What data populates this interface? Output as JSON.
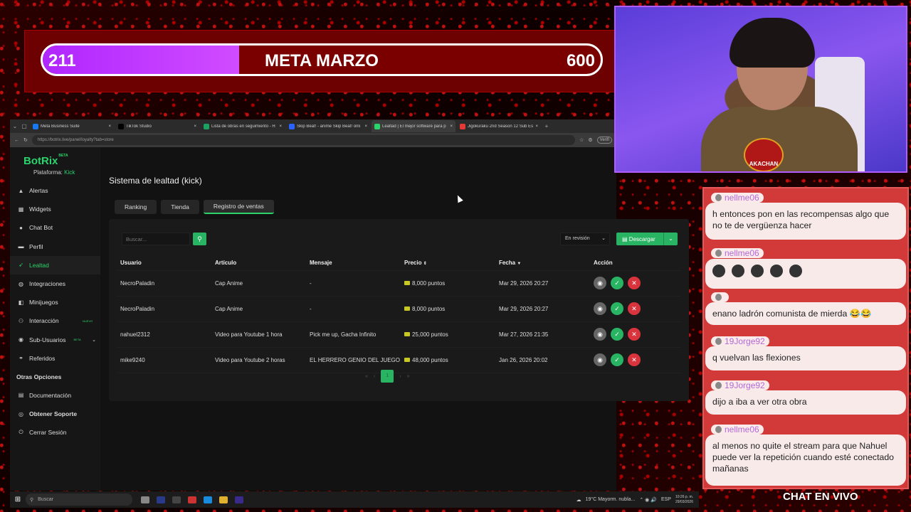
{
  "goal": {
    "current": "211",
    "title": "META MARZO",
    "max": "600",
    "progress": 0.3517,
    "fill_color": "#c040ff"
  },
  "browser": {
    "tabs": [
      {
        "label": "Meta Business Suite",
        "icon_color": "#1877f2"
      },
      {
        "label": "TikTok Studio",
        "icon_color": "#000000"
      },
      {
        "label": "Lista de obras en seguimiento - H",
        "icon_color": "#1aa260"
      },
      {
        "label": "Skip Beat! - anime Skip Beat! onli",
        "icon_color": "#2962ff"
      },
      {
        "label": "Lealtad | El mejor software para p",
        "icon_color": "#2bd46b"
      },
      {
        "label": "Jigokuraku 2nd Season 12 Sub Es",
        "icon_color": "#e53935"
      }
    ],
    "active_tab_index": 4,
    "url": "https://botrix.live/panel/loyalty?tab=store",
    "verif_label": "Verifi"
  },
  "app": {
    "logo": "BotRix",
    "logo_badge": "BETA",
    "platform_label": "Plataforma:",
    "platform_value": "Kick",
    "nav": [
      {
        "label": "Alertas",
        "icon": "warning-icon",
        "glyph": "▲"
      },
      {
        "label": "Widgets",
        "icon": "widgets-icon",
        "glyph": "▦"
      },
      {
        "label": "Chat Bot",
        "icon": "bot-icon",
        "glyph": "●"
      },
      {
        "label": "Perfil",
        "icon": "profile-icon",
        "glyph": "▬"
      },
      {
        "label": "Lealtad",
        "icon": "loyalty-icon",
        "glyph": "➶",
        "active": true
      },
      {
        "label": "Integraciones",
        "icon": "integrations-icon",
        "glyph": "◍"
      },
      {
        "label": "Minijuegos",
        "icon": "games-icon",
        "glyph": "◧"
      },
      {
        "label": "Interacción",
        "icon": "interaction-icon",
        "glyph": "⚇",
        "badge": "NUEVO"
      },
      {
        "label": "Sub-Usuarios",
        "icon": "subusers-icon",
        "glyph": "◉",
        "badge": "BETA",
        "expandable": true
      },
      {
        "label": "Referidos",
        "icon": "referrals-icon",
        "glyph": "⚭"
      }
    ],
    "section_label": "Otras Opciones",
    "other_nav": [
      {
        "label": "Documentación",
        "icon": "docs-icon",
        "glyph": "▤"
      },
      {
        "label": "Obtener Soporte",
        "icon": "support-icon",
        "glyph": "◎",
        "bold": true
      },
      {
        "label": "Cerrar Sesión",
        "icon": "logout-icon",
        "glyph": "⏻"
      }
    ],
    "page_title": "Sistema de lealtad (kick)",
    "tabs": [
      "Ranking",
      "Tienda",
      "Registro de ventas"
    ],
    "active_tab_index": 2,
    "search_placeholder": "Buscar...",
    "filter_value": "En revisión",
    "download_label": "Descargar",
    "columns": [
      "Usuario",
      "Artículo",
      "Mensaje",
      "Precio",
      "Fecha",
      "Acción"
    ],
    "rows": [
      {
        "usuario": "NecroPaladin",
        "articulo": "Cap Anime",
        "mensaje": "-",
        "precio": "8,000 puntos",
        "fecha": "Mar 29, 2026 20:27"
      },
      {
        "usuario": "NecroPaladin",
        "articulo": "Cap Anime",
        "mensaje": "-",
        "precio": "8,000 puntos",
        "fecha": "Mar 29, 2026 20:27"
      },
      {
        "usuario": "nahuel2312",
        "articulo": "Video para Youtube 1 hora",
        "mensaje": "Pick me up, Gacha Infinito",
        "precio": "25,000 puntos",
        "fecha": "Mar 27, 2026 21:35"
      },
      {
        "usuario": "mike9240",
        "articulo": "Video para Youtube 2 horas",
        "mensaje": "EL HERRERO GENIO DEL JUEGO",
        "precio": "48,000 puntos",
        "fecha": "Jan 26, 2026 20:02"
      }
    ],
    "current_page": "1",
    "accent_color": "#28b463"
  },
  "taskbar": {
    "search_label": "Buscar",
    "weather": "19°C  Mayorm. nubla...",
    "lang": "ESP",
    "time": "10:26 p. m.",
    "date": "29/03/2026"
  },
  "webcam": {
    "badge_text": "AKACHAN"
  },
  "chat": {
    "messages": [
      {
        "user": "nellme06",
        "text": "h entonces pon en las recompensas algo que no te de vergüenza hacer"
      },
      {
        "user": "nellme06",
        "text": ""
      },
      {
        "user": "",
        "text": "enano ladrón comunista de mierda 😂😂"
      },
      {
        "user": "19Jorge92",
        "text": "q vuelvan las flexiones"
      },
      {
        "user": "19Jorge92",
        "text": "dijo a iba a ver otra obra"
      },
      {
        "user": "nellme06",
        "text": "al menos no quite el stream para que Nahuel puede ver la repetición cuando esté conectado mañanas"
      }
    ],
    "title": "CHAT EN VIVO"
  }
}
